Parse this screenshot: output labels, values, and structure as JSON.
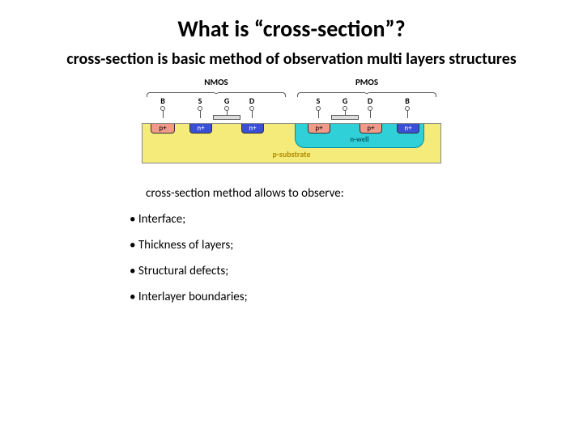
{
  "title": "What is “cross-section”?",
  "subtitle": "cross-section is basic method of observation multi layers structures",
  "diagram": {
    "groups": {
      "left": "NMOS",
      "right": "PMOS"
    },
    "pins": {
      "B": "B",
      "S": "S",
      "G": "G",
      "D": "D"
    },
    "regions": {
      "pplus": "p+",
      "nplus": "n+"
    },
    "substrate": "p-substrate",
    "nwell": "n-well"
  },
  "observe_intro": "cross-section method allows to observe:",
  "bullets": [
    "Interface;",
    "Thickness of layers;",
    "Structural defects;",
    "Interlayer boundaries;"
  ]
}
